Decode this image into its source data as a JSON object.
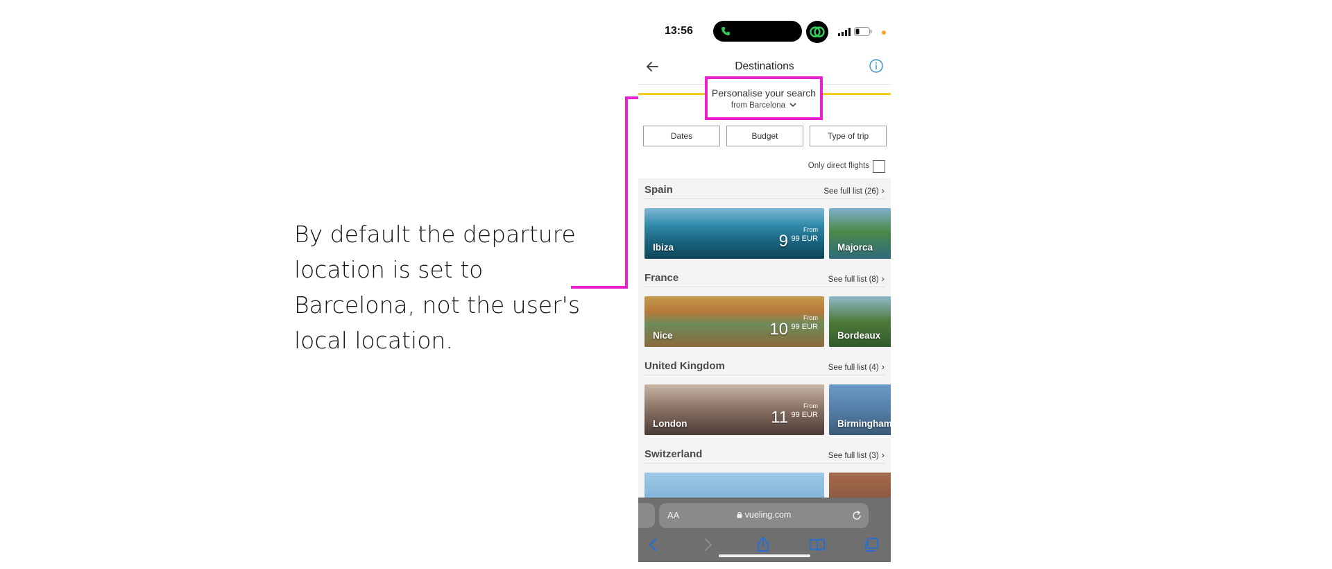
{
  "annotation": {
    "text": "By default the departure\nlocation is set to\nBarcelona, not the user's\nlocal location.",
    "highlight_color": "#e91fd0"
  },
  "status_bar": {
    "time": "13:56",
    "icons": [
      "call-icon",
      "app-badge-icon",
      "signal-icon",
      "battery-icon",
      "privacy-dot-icon"
    ]
  },
  "header": {
    "title": "Destinations",
    "back_icon": "arrow-left-icon",
    "info_icon": "info-icon"
  },
  "personalise": {
    "title": "Personalise your search",
    "origin": "from Barcelona"
  },
  "filters": [
    "Dates",
    "Budget",
    "Type of trip"
  ],
  "direct_flights": {
    "label": "Only direct flights",
    "checked": false
  },
  "sections": [
    {
      "country": "Spain",
      "see_full": "See full list (26)",
      "cards": [
        {
          "name": "Ibiza",
          "from": "From",
          "price_int": "9",
          "price_dec": "99 EUR"
        },
        {
          "name": "Majorca"
        }
      ]
    },
    {
      "country": "France",
      "see_full": "See full list (8)",
      "cards": [
        {
          "name": "Nice",
          "from": "From",
          "price_int": "10",
          "price_dec": "99 EUR"
        },
        {
          "name": "Bordeaux"
        }
      ]
    },
    {
      "country": "United Kingdom",
      "see_full": "See full list (4)",
      "cards": [
        {
          "name": "London",
          "from": "From",
          "price_int": "11",
          "price_dec": "99 EUR"
        },
        {
          "name": "Birmingham"
        }
      ]
    },
    {
      "country": "Switzerland",
      "see_full": "See full list (3)",
      "cards": []
    }
  ],
  "browser": {
    "aa_label": "AA",
    "url": "vueling.com",
    "toolbar_icons": [
      "back-icon",
      "forward-icon",
      "share-icon",
      "bookmarks-icon",
      "tabs-icon"
    ]
  },
  "colors": {
    "accent_yellow": "#f2cc1b",
    "info_blue": "#2b8fd4",
    "highlight_magenta": "#e91fd0",
    "ios_blue": "#1e6fe0"
  }
}
